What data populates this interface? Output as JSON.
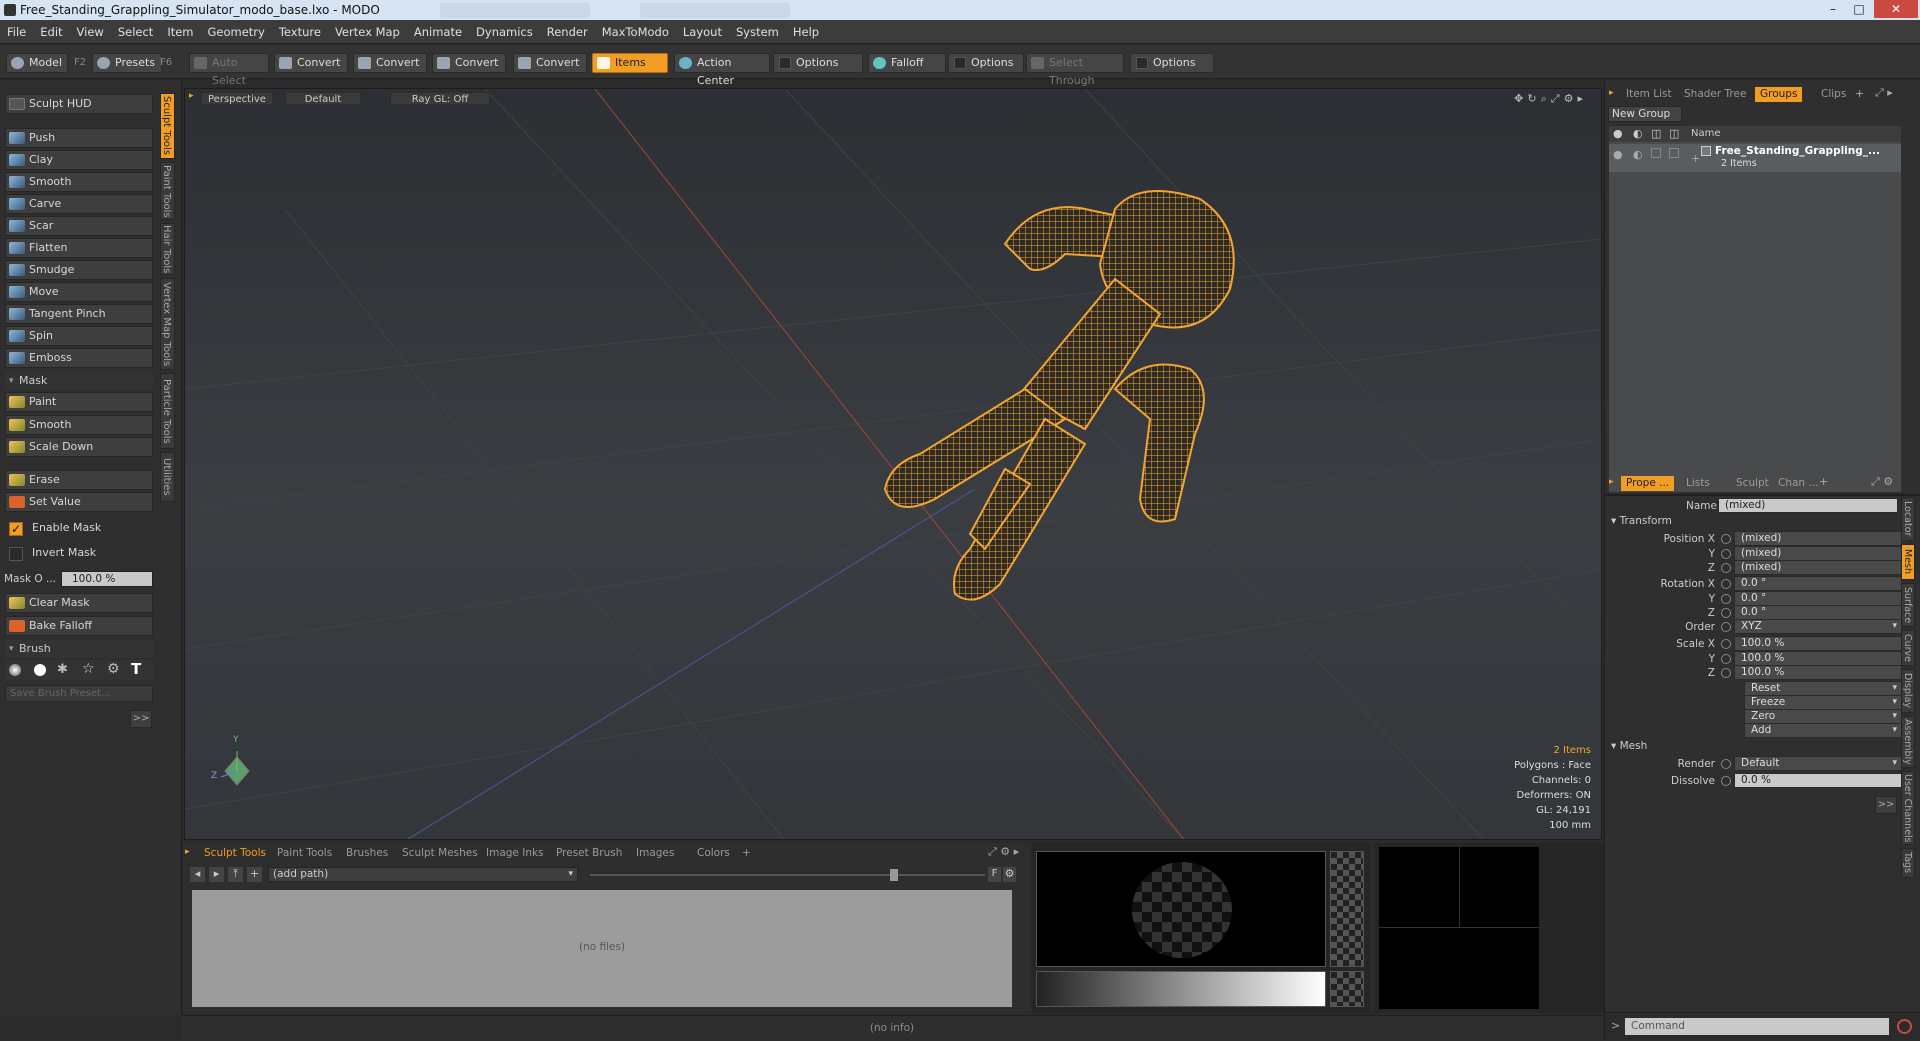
{
  "window": {
    "title": "Free_Standing_Grappling_Simulator_modo_base.lxo - MODO",
    "minimize": "–",
    "maximize": "□",
    "close": "✕"
  },
  "menu": [
    "File",
    "Edit",
    "View",
    "Select",
    "Item",
    "Geometry",
    "Texture",
    "Vertex Map",
    "Animate",
    "Dynamics",
    "Render",
    "MaxToModo",
    "Layout",
    "System",
    "Help"
  ],
  "toolbar": {
    "model": "Model",
    "model_key": "F2",
    "presets": "Presets",
    "presets_key": "F6",
    "auto_select": "Auto Select",
    "convert1": "Convert",
    "convert2": "Convert",
    "convert3": "Convert",
    "convert4": "Convert",
    "items": "Items",
    "action_center": "Action Center",
    "options1": "Options",
    "falloff": "Falloff",
    "options2": "Options",
    "select_through": "Select Through",
    "options3": "Options"
  },
  "left": {
    "hud": "Sculpt HUD",
    "tools": [
      "Push",
      "Clay",
      "Smooth",
      "Carve",
      "Scar",
      "Flatten",
      "Smudge",
      "Move",
      "Tangent Pinch",
      "Spin",
      "Emboss"
    ],
    "mask_section": "Mask",
    "mask_tools": [
      "Paint",
      "Smooth",
      "Scale Down"
    ],
    "erase": "Erase",
    "set_value": "Set Value",
    "enable_mask": "Enable Mask",
    "invert_mask": "Invert Mask",
    "mask_opacity_label": "Mask O ...",
    "mask_opacity": "100.0 %",
    "clear_mask": "Clear Mask",
    "bake_falloff": "Bake Falloff",
    "brush_section": "Brush",
    "save_brush": "Save Brush Preset...",
    "more": ">>",
    "vtabs": [
      "Sculpt Tools",
      "Paint Tools",
      "Hair Tools",
      "Vertex Map Tools",
      "Particle Tools",
      "Utilities"
    ]
  },
  "viewport": {
    "view": "Perspective",
    "shading": "Default",
    "raygl": "Ray GL: Off",
    "info": {
      "items": "2 Items",
      "polygons": "Polygons : Face",
      "channels": "Channels: 0",
      "deformers": "Deformers: ON",
      "gl": "GL: 24,191",
      "scale": "100 mm"
    },
    "axis_y": "Y",
    "axis_z": "Z"
  },
  "bottom": {
    "tabs": [
      "Sculpt Tools",
      "Paint Tools",
      "Brushes",
      "Sculpt Meshes",
      "Image Inks",
      "Preset Brush",
      "Images",
      "Colors"
    ],
    "plus": "+",
    "path": "(add path)",
    "f_btn": "F",
    "no_files": "(no files)",
    "status": "(no info)"
  },
  "groups": {
    "tabs": [
      "Item List",
      "Shader Tree",
      "Groups",
      "Clips"
    ],
    "new_group": "New Group",
    "col_name": "Name",
    "item_name": "Free_Standing_Grappling_...",
    "item_count": "2 Items"
  },
  "properties": {
    "tabs": [
      "Prope ...",
      "Lists",
      "Sculpt",
      "Chan ..."
    ],
    "name_label": "Name",
    "name_value": "(mixed)",
    "transform": "Transform",
    "rows": [
      {
        "label": "Position X",
        "value": "(mixed)"
      },
      {
        "label": "Y",
        "value": "(mixed)"
      },
      {
        "label": "Z",
        "value": "(mixed)"
      },
      {
        "label": "Rotation X",
        "value": "0.0 °"
      },
      {
        "label": "Y",
        "value": "0.0 °"
      },
      {
        "label": "Z",
        "value": "0.0 °"
      },
      {
        "label": "Order",
        "value": "XYZ"
      },
      {
        "label": "Scale X",
        "value": "100.0 %"
      },
      {
        "label": "Y",
        "value": "100.0 %"
      },
      {
        "label": "Z",
        "value": "100.0 %"
      }
    ],
    "actions": [
      "Reset",
      "Freeze",
      "Zero",
      "Add"
    ],
    "mesh": "Mesh",
    "render_label": "Render",
    "render_value": "Default",
    "dissolve_label": "Dissolve",
    "dissolve_value": "0.0 %",
    "more": ">>",
    "vtabs": [
      "Locator",
      "Mesh",
      "Surface",
      "Curve",
      "Display",
      "Assembly",
      "User Channels",
      "Tags"
    ],
    "command": "Command"
  }
}
